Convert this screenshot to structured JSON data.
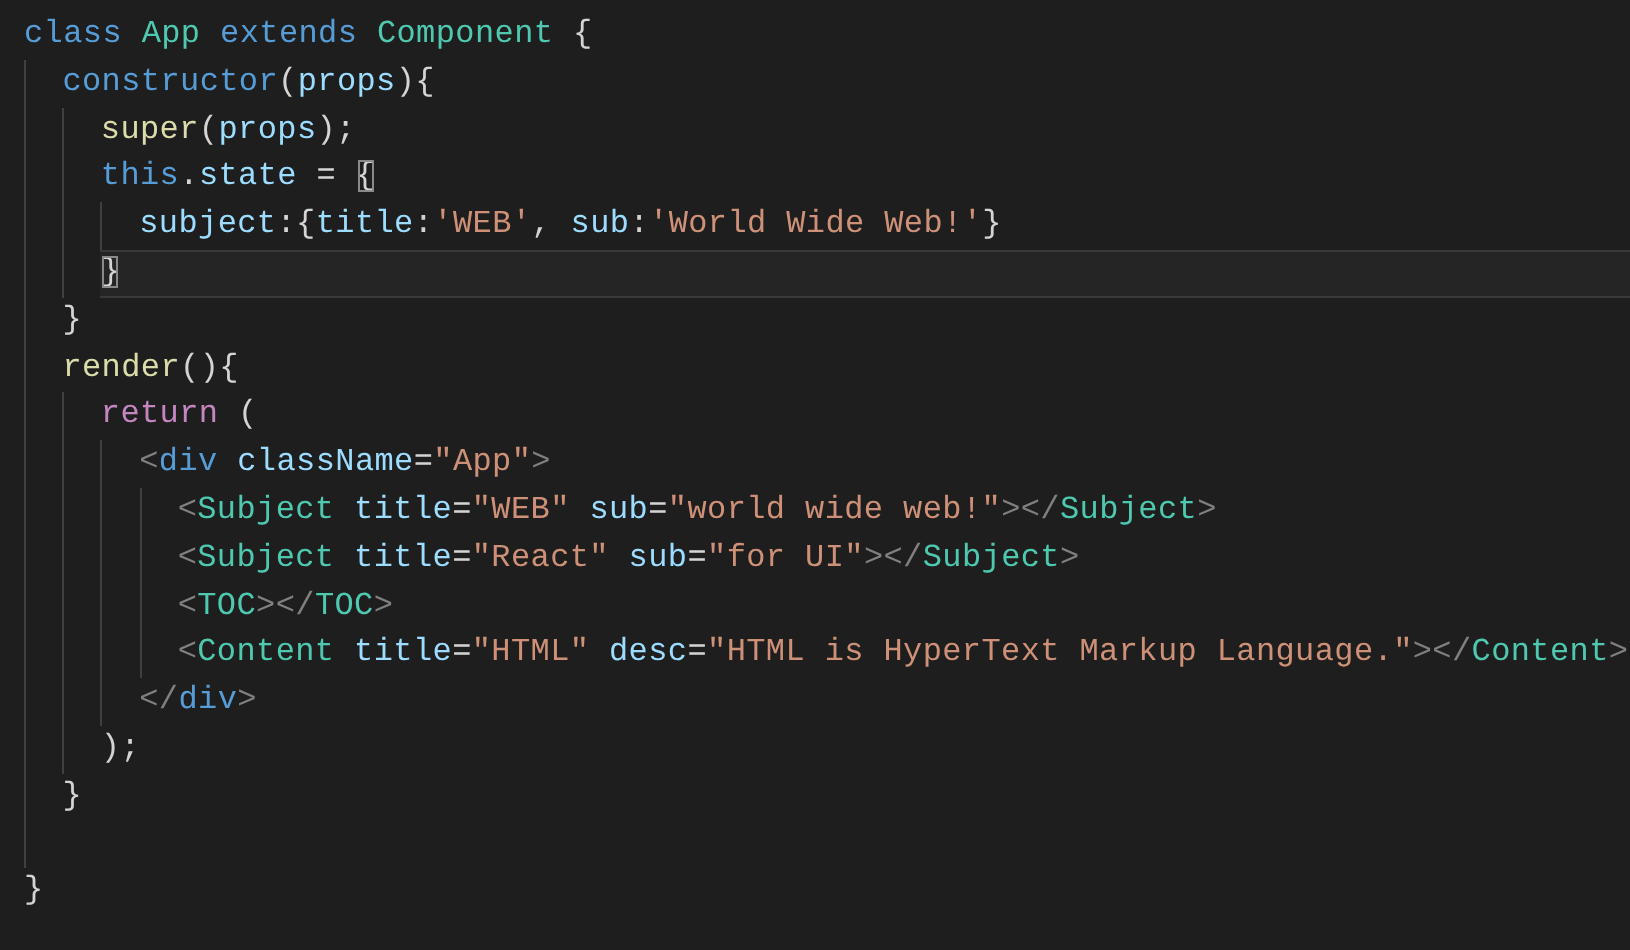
{
  "editor": {
    "lines": [
      {
        "current": false,
        "blank_before": false,
        "tokens": [
          {
            "text": "class",
            "kind": "keyword"
          },
          {
            "text": " App",
            "kind": "class"
          },
          {
            "text": " extends",
            "kind": "keyword"
          },
          {
            "text": " Component",
            "kind": "class"
          },
          {
            "text": " {",
            "kind": "punct"
          }
        ],
        "children": [
          {
            "current": false,
            "blank_before": false,
            "tokens": [
              {
                "text": "constructor",
                "kind": "keyword"
              },
              {
                "text": "(",
                "kind": "punct"
              },
              {
                "text": "props",
                "kind": "variable"
              },
              {
                "text": "){",
                "kind": "punct"
              }
            ],
            "children": [
              {
                "current": false,
                "blank_before": false,
                "tokens": [
                  {
                    "text": "super",
                    "kind": "function"
                  },
                  {
                    "text": "(",
                    "kind": "punct"
                  },
                  {
                    "text": "props",
                    "kind": "variable"
                  },
                  {
                    "text": ");",
                    "kind": "punct"
                  }
                ]
              },
              {
                "current": false,
                "blank_before": false,
                "tokens": [
                  {
                    "text": "this",
                    "kind": "keyword"
                  },
                  {
                    "text": ".",
                    "kind": "punct"
                  },
                  {
                    "text": "state",
                    "kind": "variable"
                  },
                  {
                    "text": " = ",
                    "kind": "punct"
                  },
                  {
                    "text": "{",
                    "kind": "matched"
                  }
                ],
                "children": [
                  {
                    "current": false,
                    "blank_before": false,
                    "tokens": [
                      {
                        "text": "subject",
                        "kind": "variable"
                      },
                      {
                        "text": ":{",
                        "kind": "punct"
                      },
                      {
                        "text": "title",
                        "kind": "variable"
                      },
                      {
                        "text": ":",
                        "kind": "punct"
                      },
                      {
                        "text": "'WEB'",
                        "kind": "string"
                      },
                      {
                        "text": ", ",
                        "kind": "punct"
                      },
                      {
                        "text": "sub",
                        "kind": "variable"
                      },
                      {
                        "text": ":",
                        "kind": "punct"
                      },
                      {
                        "text": "'World Wide Web!'",
                        "kind": "string"
                      },
                      {
                        "text": "}",
                        "kind": "punct"
                      }
                    ]
                  }
                ]
              },
              {
                "current": true,
                "blank_before": false,
                "tokens": [
                  {
                    "text": "}",
                    "kind": "matched"
                  }
                ]
              }
            ]
          },
          {
            "current": false,
            "blank_before": false,
            "tokens": [
              {
                "text": "}",
                "kind": "punct"
              }
            ]
          },
          {
            "current": false,
            "blank_before": false,
            "tokens": [
              {
                "text": "render",
                "kind": "function"
              },
              {
                "text": "(){",
                "kind": "punct"
              }
            ],
            "children": [
              {
                "current": false,
                "blank_before": false,
                "tokens": [
                  {
                    "text": "return",
                    "kind": "control"
                  },
                  {
                    "text": " (",
                    "kind": "punct"
                  }
                ],
                "children": [
                  {
                    "current": false,
                    "blank_before": false,
                    "tokens": [
                      {
                        "text": "<",
                        "kind": "bracket"
                      },
                      {
                        "text": "div",
                        "kind": "keyword"
                      },
                      {
                        "text": " className",
                        "kind": "variable"
                      },
                      {
                        "text": "=",
                        "kind": "punct"
                      },
                      {
                        "text": "\"App\"",
                        "kind": "string"
                      },
                      {
                        "text": ">",
                        "kind": "bracket"
                      }
                    ],
                    "children": [
                      {
                        "current": false,
                        "blank_before": false,
                        "tokens": [
                          {
                            "text": "<",
                            "kind": "bracket"
                          },
                          {
                            "text": "Subject",
                            "kind": "class"
                          },
                          {
                            "text": " title",
                            "kind": "variable"
                          },
                          {
                            "text": "=",
                            "kind": "punct"
                          },
                          {
                            "text": "\"WEB\"",
                            "kind": "string"
                          },
                          {
                            "text": " sub",
                            "kind": "variable"
                          },
                          {
                            "text": "=",
                            "kind": "punct"
                          },
                          {
                            "text": "\"world wide web!\"",
                            "kind": "string"
                          },
                          {
                            "text": "></",
                            "kind": "bracket"
                          },
                          {
                            "text": "Subject",
                            "kind": "class"
                          },
                          {
                            "text": ">",
                            "kind": "bracket"
                          }
                        ]
                      },
                      {
                        "current": false,
                        "blank_before": false,
                        "tokens": [
                          {
                            "text": "<",
                            "kind": "bracket"
                          },
                          {
                            "text": "Subject",
                            "kind": "class"
                          },
                          {
                            "text": " title",
                            "kind": "variable"
                          },
                          {
                            "text": "=",
                            "kind": "punct"
                          },
                          {
                            "text": "\"React\"",
                            "kind": "string"
                          },
                          {
                            "text": " sub",
                            "kind": "variable"
                          },
                          {
                            "text": "=",
                            "kind": "punct"
                          },
                          {
                            "text": "\"for UI\"",
                            "kind": "string"
                          },
                          {
                            "text": "></",
                            "kind": "bracket"
                          },
                          {
                            "text": "Subject",
                            "kind": "class"
                          },
                          {
                            "text": ">",
                            "kind": "bracket"
                          }
                        ]
                      },
                      {
                        "current": false,
                        "blank_before": false,
                        "tokens": [
                          {
                            "text": "<",
                            "kind": "bracket"
                          },
                          {
                            "text": "TOC",
                            "kind": "class"
                          },
                          {
                            "text": "></",
                            "kind": "bracket"
                          },
                          {
                            "text": "TOC",
                            "kind": "class"
                          },
                          {
                            "text": ">",
                            "kind": "bracket"
                          }
                        ]
                      },
                      {
                        "current": false,
                        "blank_before": false,
                        "tokens": [
                          {
                            "text": "<",
                            "kind": "bracket"
                          },
                          {
                            "text": "Content",
                            "kind": "class"
                          },
                          {
                            "text": " title",
                            "kind": "variable"
                          },
                          {
                            "text": "=",
                            "kind": "punct"
                          },
                          {
                            "text": "\"HTML\"",
                            "kind": "string"
                          },
                          {
                            "text": " desc",
                            "kind": "variable"
                          },
                          {
                            "text": "=",
                            "kind": "punct"
                          },
                          {
                            "text": "\"HTML is HyperText Markup Language.\"",
                            "kind": "string"
                          },
                          {
                            "text": "></",
                            "kind": "bracket"
                          },
                          {
                            "text": "Content",
                            "kind": "class"
                          },
                          {
                            "text": ">",
                            "kind": "bracket"
                          }
                        ]
                      }
                    ]
                  },
                  {
                    "current": false,
                    "blank_before": false,
                    "tokens": [
                      {
                        "text": "</",
                        "kind": "bracket"
                      },
                      {
                        "text": "div",
                        "kind": "keyword"
                      },
                      {
                        "text": ">",
                        "kind": "bracket"
                      }
                    ]
                  }
                ]
              },
              {
                "current": false,
                "blank_before": false,
                "tokens": [
                  {
                    "text": ");",
                    "kind": "punct"
                  }
                ]
              }
            ]
          },
          {
            "current": false,
            "blank_before": false,
            "tokens": [
              {
                "text": "}",
                "kind": "punct"
              }
            ]
          }
        ]
      },
      {
        "current": false,
        "blank_before": true,
        "tokens": [
          {
            "text": "}",
            "kind": "punct"
          }
        ]
      }
    ]
  }
}
